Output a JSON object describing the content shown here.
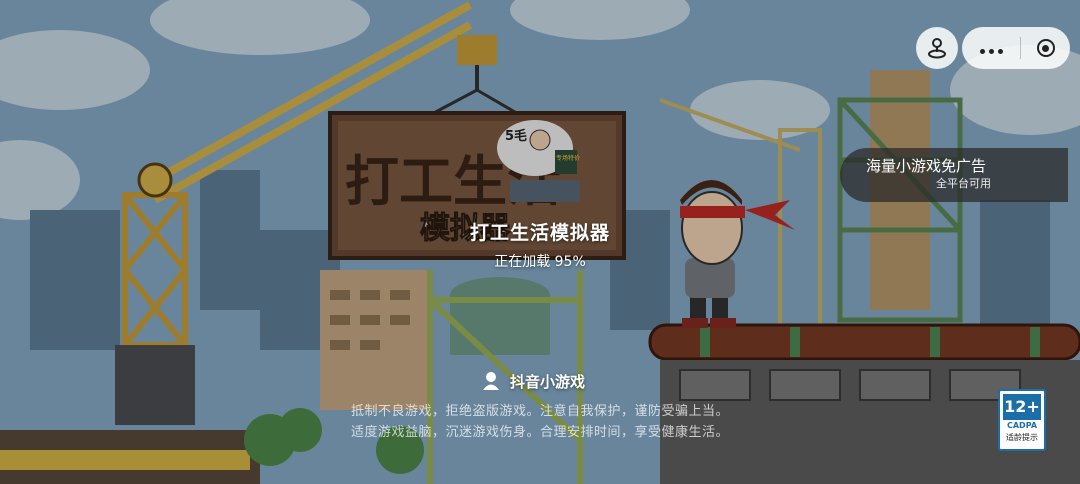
{
  "game": {
    "title": "打工生活模拟器",
    "progress_text": "正在加载 95%",
    "progress": 0.95
  },
  "ad_banner": {
    "title": "海量小游戏免广告",
    "subtitle": "全平台可用"
  },
  "platform": {
    "name": "抖音小游戏"
  },
  "notice": {
    "line1": "抵制不良游戏，拒绝盗版游戏。注意自我保护，谨防受骗上当。",
    "line2": "适度游戏益脑，沉迷游戏伤身。合理安排时间，享受健康生活。"
  },
  "age_rating": {
    "label": "12+",
    "org": "CADPA",
    "tip": "适龄提示"
  },
  "sign": {
    "logo_title": "打工生活",
    "logo_sub": "模拟器",
    "price_tag": "5毛",
    "shop_tag": "专场特价"
  },
  "icons": {
    "joystick": "joystick-icon",
    "more": "more-dots-icon",
    "close": "close-circle-icon",
    "brand": "douyin-game-logo-icon"
  },
  "colors": {
    "sky": "#7fa6c4",
    "overlay": "rgba(0,0,0,0.35)",
    "accent": "#1b6ea8"
  }
}
